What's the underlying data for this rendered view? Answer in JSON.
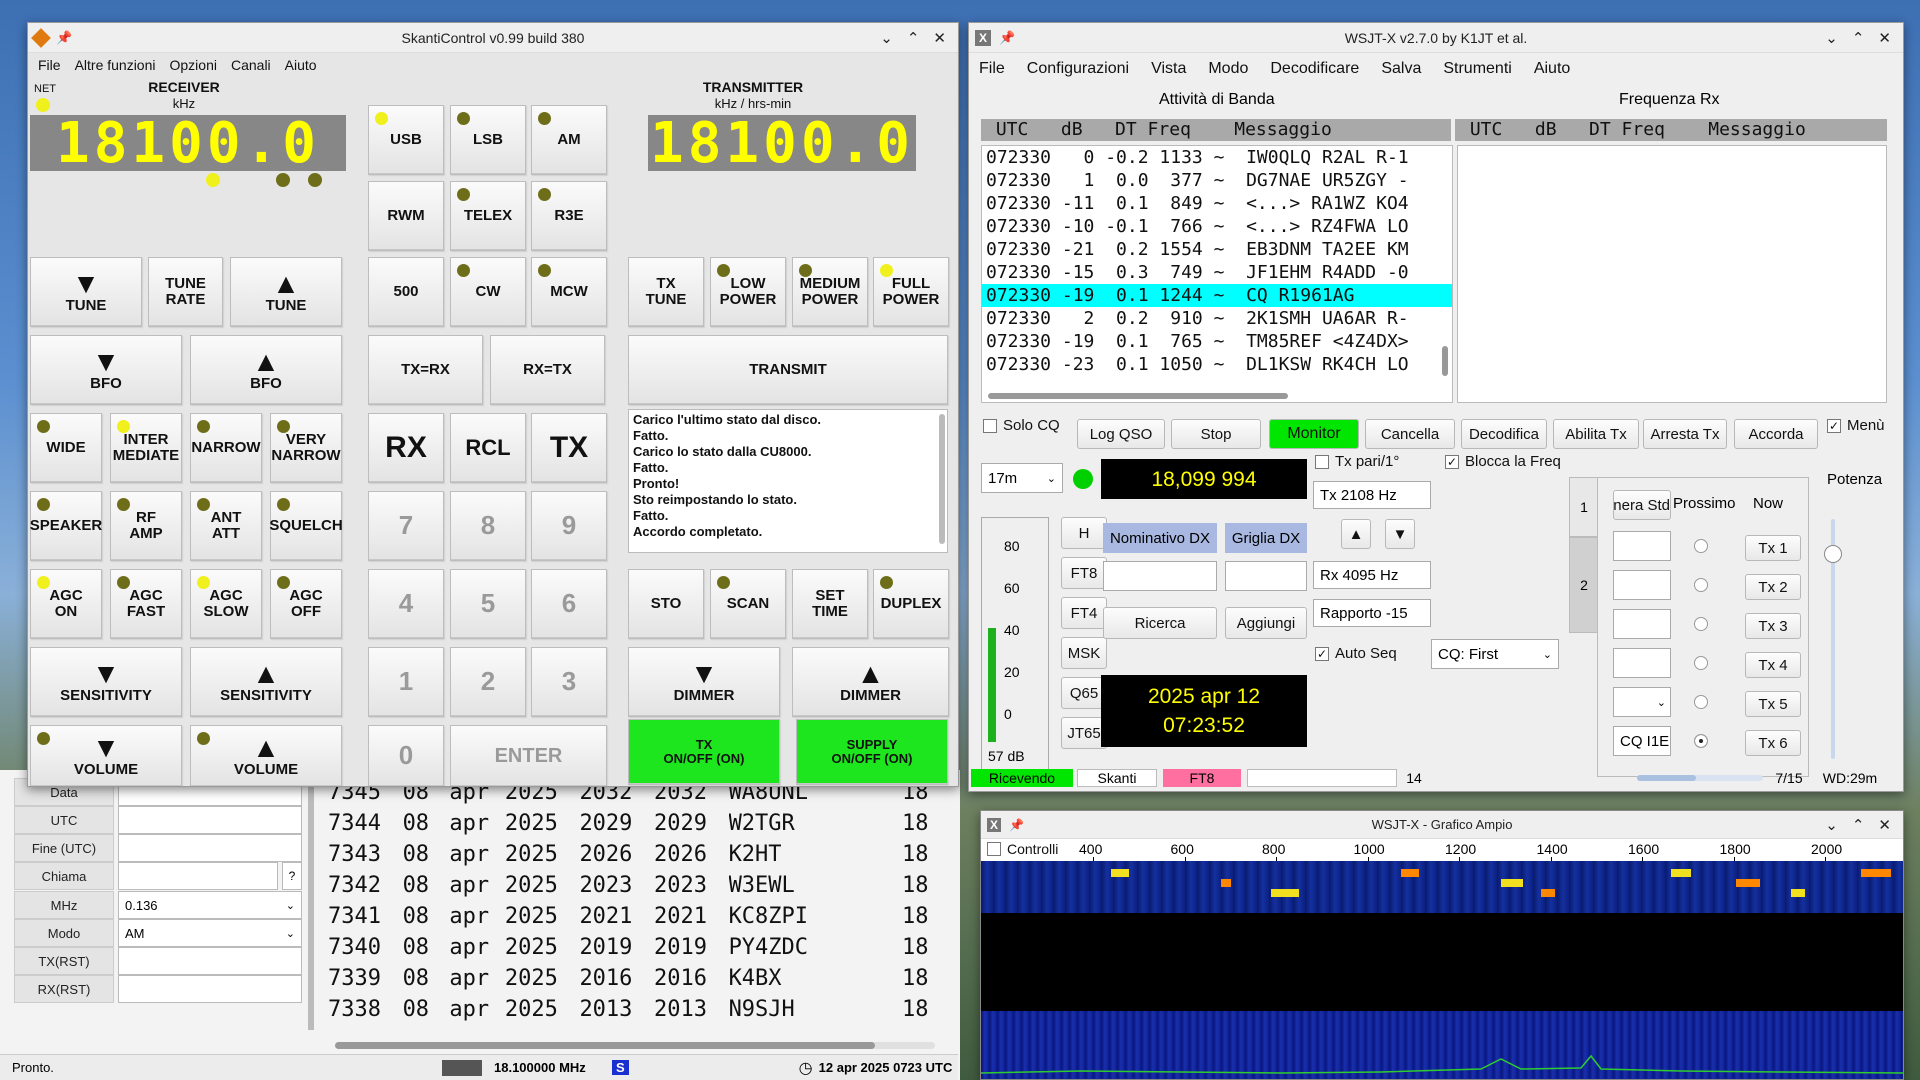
{
  "log_window": {
    "fields": [
      {
        "label": "Data",
        "value": ""
      },
      {
        "label": "UTC",
        "value": ""
      },
      {
        "label": "Fine (UTC)",
        "value": ""
      },
      {
        "label": "Chiama",
        "value": "",
        "suffix": "?"
      },
      {
        "label": "MHz",
        "value": "0.136",
        "dropdown": true
      },
      {
        "label": "Modo",
        "value": "AM",
        "dropdown": true
      },
      {
        "label": "TX(RST)",
        "value": ""
      },
      {
        "label": "RX(RST)",
        "value": ""
      }
    ],
    "rows": [
      [
        "7345",
        "08",
        "apr",
        "2025",
        "2032",
        "2032",
        "WA8UNL",
        "18"
      ],
      [
        "7344",
        "08",
        "apr",
        "2025",
        "2029",
        "2029",
        "W2TGR",
        "18"
      ],
      [
        "7343",
        "08",
        "apr",
        "2025",
        "2026",
        "2026",
        "K2HT",
        "18"
      ],
      [
        "7342",
        "08",
        "apr",
        "2025",
        "2023",
        "2023",
        "W3EWL",
        "18"
      ],
      [
        "7341",
        "08",
        "apr",
        "2025",
        "2021",
        "2021",
        "KC8ZPI",
        "18"
      ],
      [
        "7340",
        "08",
        "apr",
        "2025",
        "2019",
        "2019",
        "PY4ZDC",
        "18"
      ],
      [
        "7339",
        "08",
        "apr",
        "2025",
        "2016",
        "2016",
        "K4BX",
        "18"
      ],
      [
        "7338",
        "08",
        "apr",
        "2025",
        "2013",
        "2013",
        "N9SJH",
        "18"
      ]
    ],
    "status": {
      "left": "Pronto.",
      "freq": "18.100000 MHz",
      "mode_badge": "S",
      "datetime": "12 apr 2025 0723 UTC"
    }
  },
  "skanti": {
    "title": "SkantiControl v0.99 build 380",
    "menu": [
      "File",
      "Altre funzioni",
      "Opzioni",
      "Canali",
      "Aiuto"
    ],
    "net_label": "NET",
    "receiver_label": "RECEIVER",
    "receiver_unit": "kHz",
    "transmitter_label": "TRANSMITTER",
    "transmitter_unit": "kHz / hrs-min",
    "rx_freq": "18100.0",
    "tx_freq": "18100.0",
    "buttons": {
      "usb": "USB",
      "lsb": "LSB",
      "am": "AM",
      "rwm": "RWM",
      "telex": "TELEX",
      "r3e": "R3E",
      "f500": "500",
      "cw": "CW",
      "mcw": "MCW",
      "tune_down": "TUNE",
      "tune_rate_1": "TUNE",
      "tune_rate_2": "RATE",
      "tune_up": "TUNE",
      "tx_tune_1": "TX",
      "tx_tune_2": "TUNE",
      "low_power_1": "LOW",
      "low_power_2": "POWER",
      "medium_power_1": "MEDIUM",
      "medium_power_2": "POWER",
      "full_power_1": "FULL",
      "full_power_2": "POWER",
      "bfo_down": "BFO",
      "bfo_up": "BFO",
      "tx_eq_rx": "TX=RX",
      "rx_eq_tx": "RX=TX",
      "transmit": "TRANSMIT",
      "wide": "WIDE",
      "inter_1": "INTER",
      "inter_2": "MEDIATE",
      "narrow": "NARROW",
      "very_1": "VERY",
      "very_2": "NARROW",
      "rx": "RX",
      "rcl": "RCL",
      "tx": "TX",
      "speaker": "SPEAKER",
      "rf_1": "RF",
      "rf_2": "AMP",
      "ant_1": "ANT",
      "ant_2": "ATT",
      "squelch": "SQUELCH",
      "agc_on_1": "AGC",
      "agc_on_2": "ON",
      "agc_fast_1": "AGC",
      "agc_fast_2": "FAST",
      "agc_slow_1": "AGC",
      "agc_slow_2": "SLOW",
      "agc_off_1": "AGC",
      "agc_off_2": "OFF",
      "sto": "STO",
      "scan": "SCAN",
      "set_time_1": "SET",
      "set_time_2": "TIME",
      "duplex": "DUPLEX",
      "sens_down": "SENSITIVITY",
      "sens_up": "SENSITIVITY",
      "dimmer_down": "DIMMER",
      "dimmer_up": "DIMMER",
      "volume_down": "VOLUME",
      "volume_up": "VOLUME",
      "tx_onoff_1": "TX",
      "tx_onoff_2": "ON/OFF (ON)",
      "supply_1": "SUPPLY",
      "supply_2": "ON/OFF (ON)",
      "enter": "ENTER",
      "k7": "7",
      "k8": "8",
      "k9": "9",
      "k4": "4",
      "k5": "5",
      "k6": "6",
      "k1": "1",
      "k2": "2",
      "k3": "3",
      "k0": "0"
    },
    "messages": [
      "Carico l'ultimo stato dal disco.",
      "Fatto.",
      "Carico lo stato dalla CU8000.",
      "Fatto.",
      "Pronto!",
      "Sto reimpostando lo stato.",
      "Fatto.",
      "Accordo completato."
    ]
  },
  "wsjtx": {
    "title": "WSJT-X  v2.7.0  by K1JT et al.",
    "menu": [
      "File",
      "Configurazioni",
      "Vista",
      "Modo",
      "Decodificare",
      "Salva",
      "Strumenti",
      "Aiuto"
    ],
    "band_activity_label": "Attività di Banda",
    "rx_freq_label": "Frequenza Rx",
    "header_left": " UTC   dB   DT Freq    Messaggio",
    "header_right": " UTC   dB   DT Freq    Messaggio",
    "decodes": [
      {
        "text": "072330   0 -0.2 1133 ~  IW0QLQ R2AL R-1",
        "hl": false
      },
      {
        "text": "072330   1  0.0  377 ~  DG7NAE UR5ZGY -",
        "hl": false
      },
      {
        "text": "072330 -11  0.1  849 ~  <...> RA1WZ KO4",
        "hl": false
      },
      {
        "text": "072330 -10 -0.1  766 ~  <...> RZ4FWA LO",
        "hl": false
      },
      {
        "text": "072330 -21  0.2 1554 ~  EB3DNM TA2EE KM",
        "hl": false
      },
      {
        "text": "072330 -15  0.3  749 ~  JF1EHM R4ADD -0",
        "hl": false
      },
      {
        "text": "072330 -19  0.1 1244 ~  CQ R1961AG",
        "hl": true
      },
      {
        "text": "072330   2  0.2  910 ~  2K1SMH UA6AR R-",
        "hl": false
      },
      {
        "text": "072330 -19  0.1  765 ~  TM85REF <4Z4DX>",
        "hl": false
      },
      {
        "text": "072330 -23  0.1 1050 ~  DL1KSW RK4CH LO",
        "hl": false
      }
    ],
    "controls": {
      "solo_cq": "Solo CQ",
      "log_qso": "Log QSO",
      "stop": "Stop",
      "monitor": "Monitor",
      "cancella": "Cancella",
      "decodifica": "Decodifica",
      "abilita_tx": "Abilita Tx",
      "arresta_tx": "Arresta Tx",
      "accorda": "Accorda",
      "menu": "Menù"
    },
    "band": "17m",
    "dial_freq": "18,099 994",
    "tx_pari": "Tx pari/1°",
    "blocca": "Blocca la Freq",
    "tx_hz": "Tx  2108  Hz",
    "rx_hz": "Rx  4095  Hz",
    "rapporto": "Rapporto -15",
    "auto_seq": "Auto Seq",
    "cq_first": "CQ: First",
    "mode_buttons": [
      "H",
      "FT8",
      "FT4",
      "MSK",
      "Q65",
      "JT65"
    ],
    "nominativo_dx": "Nominativo DX",
    "griglia_dx": "Griglia DX",
    "ricerca": "Ricerca",
    "aggiungi": "Aggiungi",
    "date": "2025 apr 12",
    "time": "07:23:52",
    "meter_ticks": [
      "80",
      "60",
      "40",
      "20",
      "0"
    ],
    "meter_db": "57 dB",
    "tab1": "1",
    "tab2": "2",
    "gen_std": "Genera Std",
    "prossimo": "Prossimo",
    "now": "Now",
    "tx_buttons": [
      "Tx 1",
      "Tx 2",
      "Tx 3",
      "Tx 4",
      "Tx 5",
      "Tx 6"
    ],
    "tx6_msg": "CQ I1E",
    "potenza": "Potenza",
    "status": {
      "ricevendo": "Ricevendo",
      "skanti": "Skanti",
      "mode": "FT8",
      "num": "14",
      "progress": "7/15",
      "wd": "WD:29m"
    },
    "progress_fraction": 0.47,
    "meter_level": 0.57
  },
  "wide_graph": {
    "title": "WSJT-X - Grafico Ampio",
    "controlli": "Controlli",
    "freq_ticks": [
      "400",
      "600",
      "800",
      "1000",
      "1200",
      "1400",
      "1600",
      "1800",
      "2000"
    ]
  },
  "colors": {
    "led_on": "#f0f01c",
    "led_off": "#6e6e1a",
    "freq_yellow": "#ffff00",
    "monitor_green": "#00e600",
    "highlight_cyan": "#00ffff",
    "ft8_pink": "#ff6fa0"
  }
}
